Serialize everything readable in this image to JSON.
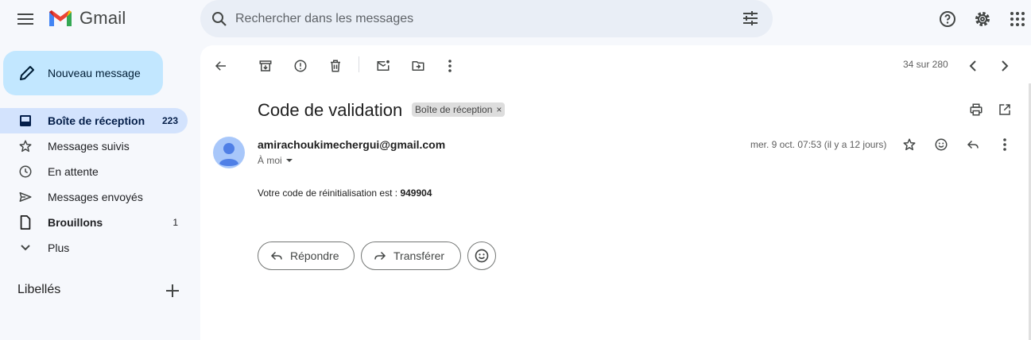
{
  "header": {
    "app_name": "Gmail",
    "search_placeholder": "Rechercher dans les messages"
  },
  "sidebar": {
    "compose_label": "Nouveau message",
    "items": [
      {
        "label": "Boîte de réception",
        "count": "223",
        "icon": "inbox-icon"
      },
      {
        "label": "Messages suivis",
        "count": "",
        "icon": "star-icon"
      },
      {
        "label": "En attente",
        "count": "",
        "icon": "clock-icon"
      },
      {
        "label": "Messages envoyés",
        "count": "",
        "icon": "send-icon"
      },
      {
        "label": "Brouillons",
        "count": "1",
        "icon": "draft-icon"
      },
      {
        "label": "Plus",
        "count": "",
        "icon": "chevron-down-icon"
      }
    ],
    "labels_heading": "Libellés"
  },
  "toolbar": {
    "pagination": "34 sur 280"
  },
  "email": {
    "subject": "Code de validation",
    "label_chip": "Boîte de réception",
    "label_chip_close": "×",
    "sender": "amirachoukimechergui@gmail.com",
    "recipient": "À moi",
    "date": "mer. 9 oct. 07:53 (il y a 12 jours)",
    "body_text": "Votre code de réinitialisation est : ",
    "code": "949904"
  },
  "actions": {
    "reply_label": "Répondre",
    "forward_label": "Transférer"
  },
  "colors": {
    "background": "#f6f8fc",
    "compose": "#c2e7ff",
    "active_nav": "#d3e3fd",
    "search": "#e9eef6",
    "avatar": "#4f7fe6"
  }
}
